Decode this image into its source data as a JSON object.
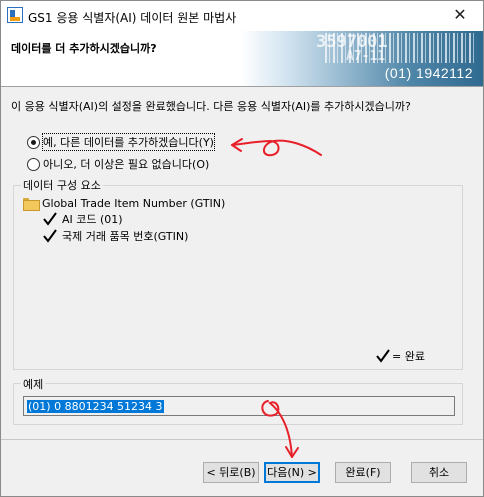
{
  "window": {
    "title": "GS1 응용 식별자(AI) 데이터 원본 마법사",
    "close_glyph": "✕"
  },
  "banner": {
    "question": "데이터를 더 추가하시겠습니까?",
    "art_number_1": "3597001",
    "art_number_2": "A7-11",
    "art_code": "(01) 1942112"
  },
  "intro_text": "이 응용 식별자(AI)의 설정을 완료했습니다. 다른 응용 식별자(AI)를 추가하시겠습니까?",
  "options": [
    {
      "label": "예, 다른 데이터를 추가하겠습니다(Y)",
      "checked": true
    },
    {
      "label": "아니오, 더 이상은 필요 없습니다(O)",
      "checked": false
    }
  ],
  "components": {
    "group_title": "데이터 구성 요소",
    "root_label": "Global Trade Item Number (GTIN)",
    "items": [
      "AI 코드 (01)",
      "국제 거래 품목 번호(GTIN)"
    ],
    "legend_label": "= 완료"
  },
  "example": {
    "group_title": "예제",
    "value": "(01) 0 8801234 51234 3"
  },
  "buttons": {
    "back": "< 뒤로(B)",
    "next": "다음(N) >",
    "finish": "완료(F)",
    "cancel": "취소"
  },
  "colors": {
    "selection": "#0078d7",
    "annotation": "#e8202a"
  }
}
